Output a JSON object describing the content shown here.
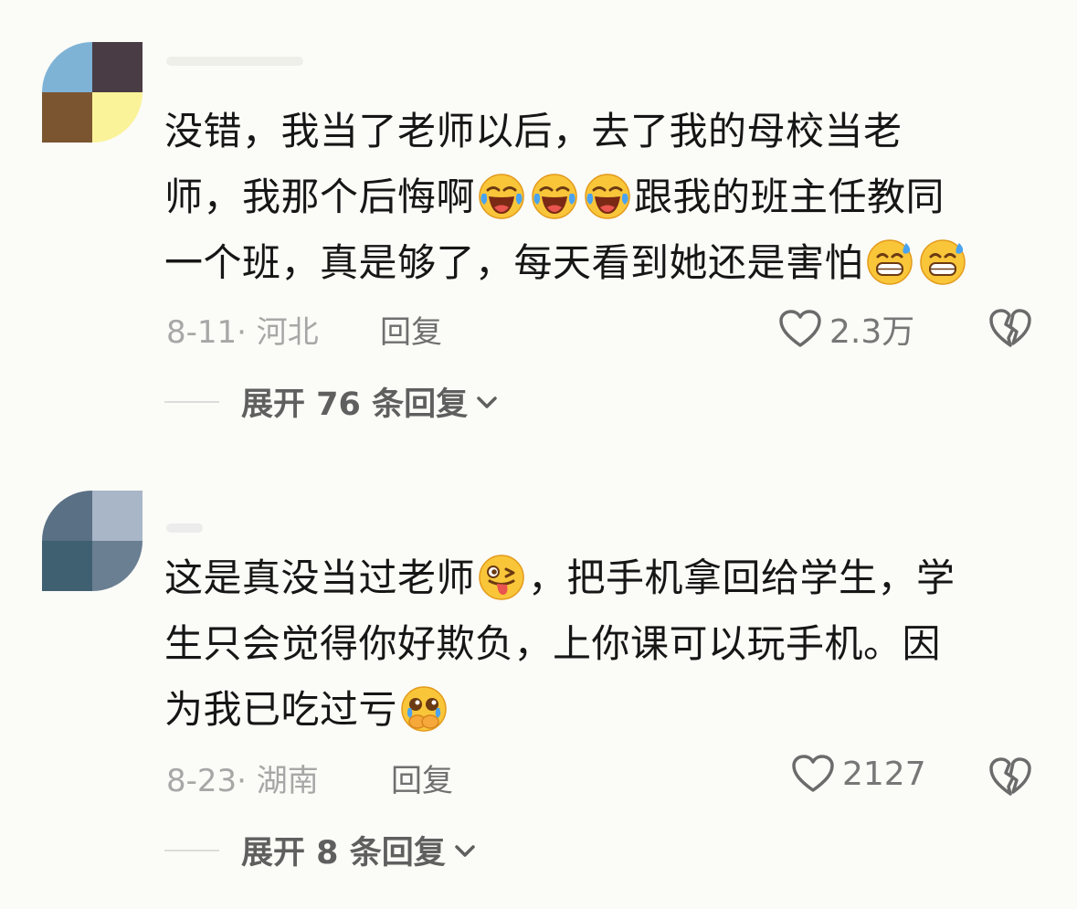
{
  "comments": [
    {
      "lines": [
        [
          {
            "t": "没错，我当了老师以后，去了我的母校当老"
          }
        ],
        [
          {
            "t": "师，我那个后悔啊"
          },
          {
            "e": "laugh-cry"
          },
          {
            "e": "laugh-cry"
          },
          {
            "e": "laugh-cry"
          },
          {
            "t": "跟我的班主任教同"
          }
        ],
        [
          {
            "t": "一个班，真是够了，每天看到她还是害怕"
          },
          {
            "e": "grin-sweat"
          },
          {
            "e": "grin-sweat"
          }
        ]
      ],
      "meta": "8-11· 河北",
      "reply_label": "回复",
      "likes": "2.3万",
      "expand_label": "展开 76 条回复",
      "avatar_colors": [
        "#7fb3d6",
        "#4a3c44",
        "#7a5530",
        "#fbf39a"
      ]
    },
    {
      "lines": [
        [
          {
            "t": "这是真没当过老师"
          },
          {
            "e": "wink-tongue"
          },
          {
            "t": "，把手机拿回给学生，学"
          }
        ],
        [
          {
            "t": "生只会觉得你好欺负，上你课可以玩手机。因"
          }
        ],
        [
          {
            "t": "为我已吃过亏"
          },
          {
            "e": "pleading"
          }
        ]
      ],
      "meta": "8-23· 湖南",
      "reply_label": "回复",
      "likes": "2127",
      "expand_label": "展开 8 条回复",
      "avatar_colors": [
        "#5a7085",
        "#a8b6c7",
        "#3f6070",
        "#6a7f92"
      ]
    }
  ]
}
